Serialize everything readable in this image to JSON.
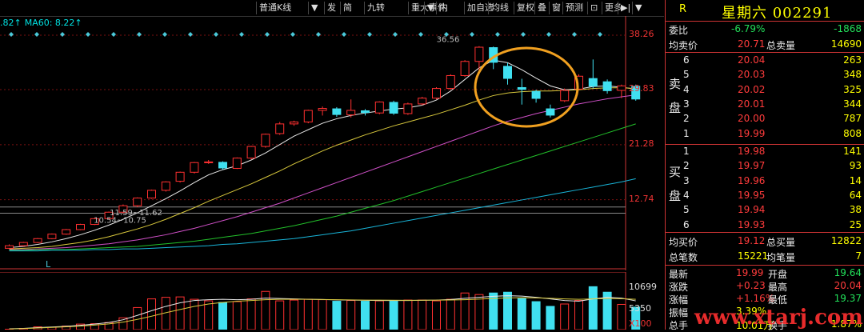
{
  "toolbar": {
    "buttons": [
      "普通K线",
      "▼",
      "发",
      "简",
      "九转",
      "重大事件",
      "▼",
      "内",
      "加自选",
      "均线",
      "复权",
      "叠",
      "窗",
      "预测",
      "⊡",
      "更多",
      "▶|",
      "▼"
    ]
  },
  "ma_legend": [
    {
      "text": ".82↑",
      "color": "#00e0e0"
    },
    {
      "text": "MA60: 8.22↑",
      "color": "#00e0e0"
    }
  ],
  "chart_data": [
    {
      "type": "candlestick",
      "title": "",
      "y_ticks": [
        38.26,
        29.83,
        21.28,
        12.74
      ],
      "ylim": [
        4.5,
        40.5
      ],
      "annotations": [
        {
          "text": "36.56",
          "at_price": 36.56
        },
        {
          "text": "11.59~11.62",
          "at_price": 11.6
        },
        {
          "text": "10.54~10.75",
          "at_price": 10.65
        }
      ],
      "x_label_bottom": "L",
      "candles": [
        {
          "o": 5.2,
          "c": 5.6,
          "h": 5.8,
          "l": 5.1
        },
        {
          "o": 5.6,
          "c": 6.1,
          "h": 6.2,
          "l": 5.5
        },
        {
          "o": 6.1,
          "c": 6.7,
          "h": 6.8,
          "l": 6.0
        },
        {
          "o": 6.7,
          "c": 7.4,
          "h": 7.5,
          "l": 6.6
        },
        {
          "o": 7.4,
          "c": 8.1,
          "h": 8.2,
          "l": 7.3
        },
        {
          "o": 8.1,
          "c": 8.9,
          "h": 9.0,
          "l": 8.0
        },
        {
          "o": 8.9,
          "c": 9.8,
          "h": 9.9,
          "l": 8.8
        },
        {
          "o": 9.8,
          "c": 10.8,
          "h": 10.9,
          "l": 9.7
        },
        {
          "o": 10.8,
          "c": 11.8,
          "h": 12.0,
          "l": 10.6
        },
        {
          "o": 11.8,
          "c": 13.0,
          "h": 13.1,
          "l": 11.6
        },
        {
          "o": 13.0,
          "c": 14.2,
          "h": 14.3,
          "l": 12.9
        },
        {
          "o": 14.2,
          "c": 15.5,
          "h": 15.6,
          "l": 14.0
        },
        {
          "o": 15.6,
          "c": 17.0,
          "h": 17.1,
          "l": 15.4
        },
        {
          "o": 17.0,
          "c": 18.5,
          "h": 18.6,
          "l": 16.8
        },
        {
          "o": 18.6,
          "c": 18.6,
          "h": 18.9,
          "l": 18.3
        },
        {
          "o": 18.6,
          "c": 17.6,
          "h": 18.7,
          "l": 17.4
        },
        {
          "o": 17.6,
          "c": 19.2,
          "h": 19.3,
          "l": 17.5
        },
        {
          "o": 19.2,
          "c": 21.0,
          "h": 21.1,
          "l": 19.0
        },
        {
          "o": 21.0,
          "c": 22.9,
          "h": 23.0,
          "l": 20.8
        },
        {
          "o": 23.0,
          "c": 24.5,
          "h": 24.8,
          "l": 22.8
        },
        {
          "o": 24.5,
          "c": 24.8,
          "h": 25.0,
          "l": 24.2
        },
        {
          "o": 24.8,
          "c": 26.6,
          "h": 26.7,
          "l": 24.6
        },
        {
          "o": 26.6,
          "c": 26.9,
          "h": 27.2,
          "l": 25.8
        },
        {
          "o": 26.9,
          "c": 25.9,
          "h": 27.1,
          "l": 25.6
        },
        {
          "o": 25.9,
          "c": 26.6,
          "h": 28.3,
          "l": 25.5
        },
        {
          "o": 26.6,
          "c": 26.2,
          "h": 26.8,
          "l": 25.8
        },
        {
          "o": 26.2,
          "c": 27.9,
          "h": 28.0,
          "l": 26.0
        },
        {
          "o": 27.9,
          "c": 26.1,
          "h": 28.1,
          "l": 25.9
        },
        {
          "o": 26.1,
          "c": 27.6,
          "h": 27.8,
          "l": 25.9
        },
        {
          "o": 27.6,
          "c": 28.5,
          "h": 28.7,
          "l": 27.4
        },
        {
          "o": 28.5,
          "c": 30.0,
          "h": 30.2,
          "l": 28.3
        },
        {
          "o": 30.0,
          "c": 32.0,
          "h": 32.2,
          "l": 29.8
        },
        {
          "o": 32.0,
          "c": 34.2,
          "h": 34.4,
          "l": 31.8
        },
        {
          "o": 34.2,
          "c": 36.4,
          "h": 36.56,
          "l": 32.5
        },
        {
          "o": 36.4,
          "c": 34.0,
          "h": 36.5,
          "l": 33.0
        },
        {
          "o": 33.5,
          "c": 31.5,
          "h": 34.0,
          "l": 30.6
        },
        {
          "o": 30.2,
          "c": 29.8,
          "h": 31.5,
          "l": 27.5
        },
        {
          "o": 29.6,
          "c": 28.4,
          "h": 29.8,
          "l": 27.8
        },
        {
          "o": 26.9,
          "c": 25.8,
          "h": 27.5,
          "l": 25.5
        },
        {
          "o": 28.1,
          "c": 29.7,
          "h": 30.0,
          "l": 27.9
        },
        {
          "o": 29.9,
          "c": 31.9,
          "h": 32.2,
          "l": 29.8
        },
        {
          "o": 31.6,
          "c": 30.3,
          "h": 34.5,
          "l": 30.0
        },
        {
          "o": 31.1,
          "c": 29.6,
          "h": 31.4,
          "l": 29.2
        },
        {
          "o": 29.7,
          "c": 30.4,
          "h": 30.6,
          "l": 28.5
        },
        {
          "o": 30.4,
          "c": 28.3,
          "h": 30.6,
          "l": 28.1
        }
      ],
      "ma_lines": [
        {
          "color": "#e8e8e8",
          "values": [
            5.3,
            5.5,
            5.8,
            6.2,
            6.7,
            7.3,
            8.0,
            8.8,
            9.7,
            10.7,
            11.8,
            12.9,
            14.1,
            15.4,
            16.6,
            17.4,
            18.0,
            18.9,
            20.0,
            21.3,
            22.6,
            23.6,
            24.6,
            25.3,
            25.8,
            26.2,
            26.5,
            26.8,
            27.0,
            27.4,
            28.2,
            29.6,
            31.4,
            33.2,
            34.4,
            34.0,
            32.9,
            31.6,
            30.4,
            29.8,
            29.9,
            30.3,
            30.4,
            30.2,
            29.9
          ]
        },
        {
          "color": "#d8c83c",
          "values": [
            5.1,
            5.2,
            5.3,
            5.5,
            5.8,
            6.1,
            6.5,
            7.0,
            7.6,
            8.2,
            8.9,
            9.7,
            10.6,
            11.5,
            12.5,
            13.4,
            14.3,
            15.2,
            16.2,
            17.2,
            18.3,
            19.3,
            20.3,
            21.2,
            22.0,
            22.8,
            23.5,
            24.2,
            24.8,
            25.4,
            26.0,
            26.7,
            27.4,
            28.2,
            28.9,
            29.3,
            29.5,
            29.6,
            29.6,
            29.7,
            29.8,
            30.0,
            30.1,
            30.1,
            30.0
          ]
        },
        {
          "color": "#d050c8",
          "values": [
            5.0,
            5.0,
            5.1,
            5.2,
            5.3,
            5.5,
            5.7,
            5.9,
            6.2,
            6.5,
            6.9,
            7.3,
            7.8,
            8.3,
            8.9,
            9.5,
            10.1,
            10.8,
            11.5,
            12.2,
            13.0,
            13.8,
            14.6,
            15.4,
            16.2,
            17.0,
            17.8,
            18.6,
            19.4,
            20.2,
            21.0,
            21.8,
            22.6,
            23.4,
            24.2,
            24.9,
            25.5,
            26.1,
            26.6,
            27.1,
            27.6,
            28.0,
            28.4,
            28.7,
            29.0
          ]
        },
        {
          "color": "#22c02a",
          "values": [
            4.9,
            4.9,
            5.0,
            5.0,
            5.0,
            5.1,
            5.2,
            5.3,
            5.4,
            5.5,
            5.7,
            5.9,
            6.1,
            6.3,
            6.6,
            6.9,
            7.2,
            7.5,
            7.9,
            8.3,
            8.7,
            9.2,
            9.7,
            10.2,
            10.8,
            11.4,
            12.0,
            12.6,
            13.3,
            14.0,
            14.7,
            15.4,
            16.1,
            16.8,
            17.5,
            18.2,
            18.9,
            19.6,
            20.3,
            21.0,
            21.7,
            22.4,
            23.1,
            23.8,
            24.5
          ]
        },
        {
          "color": "#18b4d8",
          "values": [
            4.8,
            4.8,
            4.8,
            4.9,
            4.9,
            4.9,
            5.0,
            5.0,
            5.1,
            5.1,
            5.2,
            5.3,
            5.4,
            5.5,
            5.6,
            5.8,
            5.9,
            6.1,
            6.3,
            6.5,
            6.7,
            7.0,
            7.3,
            7.6,
            7.9,
            8.3,
            8.7,
            9.1,
            9.5,
            9.9,
            10.3,
            10.7,
            11.1,
            11.5,
            11.9,
            12.3,
            12.7,
            13.1,
            13.5,
            13.9,
            14.3,
            14.7,
            15.1,
            15.5,
            16.0
          ]
        }
      ]
    },
    {
      "type": "bar",
      "title": "",
      "y_ticks": [
        10699,
        5350
      ],
      "unit_label": "X100",
      "ylim": [
        0,
        13000
      ],
      "values": [
        100,
        300,
        700,
        600,
        900,
        1400,
        1500,
        1800,
        3000,
        5600,
        7800,
        8200,
        8300,
        7700,
        7300,
        7000,
        7100,
        7800,
        9700,
        7300,
        7500,
        7700,
        7600,
        7300,
        7400,
        7300,
        7300,
        7300,
        7500,
        7500,
        7300,
        7700,
        9300,
        8900,
        9400,
        9600,
        8000,
        7200,
        6000,
        6500,
        7400,
        11000,
        9600,
        6400,
        5800
      ],
      "ma_lines": [
        {
          "color": "#e8e8e8",
          "values": [
            200,
            300,
            500,
            650,
            850,
            1100,
            1400,
            1800,
            2500,
            3600,
            4800,
            5900,
            6800,
            7400,
            7600,
            7700,
            7600,
            7700,
            8000,
            7900,
            7800,
            7700,
            7650,
            7550,
            7500,
            7450,
            7400,
            7380,
            7400,
            7450,
            7500,
            7650,
            7950,
            8200,
            8450,
            8600,
            8500,
            8200,
            7800,
            7400,
            7200,
            7800,
            8200,
            8000,
            7300
          ]
        },
        {
          "color": "#d8c83c",
          "values": [
            150,
            250,
            400,
            550,
            700,
            900,
            1150,
            1450,
            1900,
            2600,
            3400,
            4300,
            5100,
            5900,
            6500,
            6900,
            7200,
            7400,
            7600,
            7700,
            7700,
            7700,
            7650,
            7600,
            7550,
            7500,
            7480,
            7460,
            7450,
            7460,
            7480,
            7520,
            7600,
            7750,
            7900,
            8050,
            8100,
            8050,
            7950,
            7800,
            7700,
            7800,
            7900,
            7850,
            7700
          ]
        }
      ]
    }
  ],
  "panel": {
    "r_label": "R",
    "stock_name": "星期六 002291",
    "weibi_label": "委比",
    "weibi_pct": "-6.79%",
    "weibi_val": "-1868",
    "junmai_label": "均卖价",
    "junmai_val": "20.71",
    "zongmai_label": "总卖量",
    "zongmai_val": "14690",
    "sell_side": "卖",
    "sell_side2": "盘",
    "sells": [
      {
        "n": "6",
        "p": "20.04",
        "v": "263"
      },
      {
        "n": "5",
        "p": "20.03",
        "v": "348"
      },
      {
        "n": "4",
        "p": "20.02",
        "v": "325"
      },
      {
        "n": "3",
        "p": "20.01",
        "v": "344"
      },
      {
        "n": "2",
        "p": "20.00",
        "v": "787"
      },
      {
        "n": "1",
        "p": "19.99",
        "v": "808"
      }
    ],
    "buy_side": "买",
    "buy_side2": "盘",
    "buys": [
      {
        "n": "1",
        "p": "19.98",
        "v": "141"
      },
      {
        "n": "2",
        "p": "19.97",
        "v": "93"
      },
      {
        "n": "3",
        "p": "19.96",
        "v": "14"
      },
      {
        "n": "4",
        "p": "19.95",
        "v": "64"
      },
      {
        "n": "5",
        "p": "19.94",
        "v": "38"
      },
      {
        "n": "6",
        "p": "19.93",
        "v": "25"
      }
    ],
    "junmai2_label": "均买价",
    "junmai2_val": "19.12",
    "zongmai2_label": "总买量",
    "zongmai2_val": "12822",
    "zbs_label": "总笔数",
    "zbs_val": "15221",
    "jbl_label": "均笔量",
    "jbl_val": "7",
    "stats": [
      {
        "l1": "最新",
        "v1": "19.99",
        "c1": "red",
        "l2": "开盘",
        "v2": "19.64",
        "c2": "green"
      },
      {
        "l1": "涨跌",
        "v1": "+0.23",
        "c1": "red",
        "l2": "最高",
        "v2": "20.04",
        "c2": "red"
      },
      {
        "l1": "涨幅",
        "v1": "+1.16%",
        "c1": "red",
        "l2": "最低",
        "v2": "19.37",
        "c2": "green"
      },
      {
        "l1": "振幅",
        "v1": "3.39%",
        "c1": "yel",
        "l2": "",
        "v2": "",
        "c2": "wht"
      },
      {
        "l1": "总手",
        "v1": "10.01万",
        "c1": "yel",
        "l2": "换手",
        "v2": "1.87%",
        "c2": "yel"
      }
    ],
    "watermark": "www.xtarj.com"
  }
}
